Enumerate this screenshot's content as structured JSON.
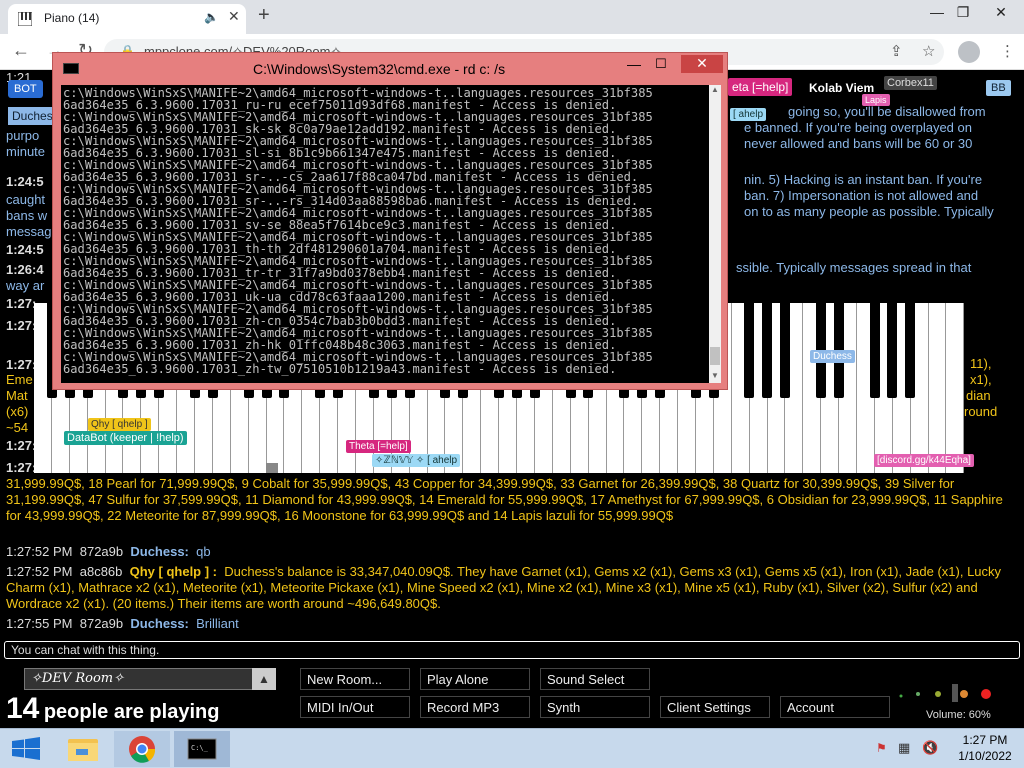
{
  "browser": {
    "tab_title": "Piano (14)",
    "url": "mppclone.com/?c=%E2%9C%A7DEV%20Room%E2%9C%A7",
    "url_display": "mppclone.com/✧DEV%20Room✧"
  },
  "page": {
    "bot_badge": "BOT",
    "duchess_tag": "Duches",
    "top_right_tag": "eta [=help]",
    "kolab": "Kolab Viem",
    "lapis": "Lapis",
    "corbex": "Corbex11",
    "bb": "BB",
    "right_chat_1": "going so, you'll be disallowed from",
    "right_chat_2": "e banned. If you're being overplayed on",
    "right_chat_3": "never allowed and bans will be 60 or 30",
    "right_chat_4": "nin. 5) Hacking is an instant ban. If you're",
    "right_chat_5": "ban. 7) Impersonation is not allowed and",
    "right_chat_6": "on to as many people as possible. Typically",
    "right_chat_7": "ssible. Typically messages spread in that",
    "left_frag_1": "1:21",
    "left_frag_2": "purpo",
    "left_frag_3": "minute",
    "left_frag_4": "1:24:5",
    "left_frag_5": "caught",
    "left_frag_6": "bans w",
    "left_frag_7": "messag",
    "left_frag_8": "1:24:5",
    "left_frag_9": "1:26:4",
    "left_frag_10": "way ar",
    "left_frag_11": "1:27:",
    "left_frag_12": "1:27:",
    "left_frag_13": "1:27:",
    "left_frag_14": "Eme",
    "left_frag_15": "Mat",
    "left_frag_16": "(x6)",
    "left_frag_17": "~54",
    "left_frag_18": "1:27:",
    "left_frag_19": "1:27:",
    "right_frag_1": "11),",
    "right_frag_2": "x1),",
    "right_frag_3": "dian",
    "right_frag_4": "round",
    "ahelp_tag": "[ ahelp",
    "qhy_tag": "Qhy [ qhelp ]",
    "databot_tag": "DataBot (keeper | !help)",
    "theta_tag": "Theta [=help]",
    "mid_tag": "✧ℤℕ𝕍𝕐 ✧ [ ahelp",
    "duchess_cursor": "Duchess",
    "discord_tag": "[discord.gg/k44Eqha]",
    "chat_market": "31,999.99Q$, 18 Pearl for 71,999.99Q$, 9 Cobalt for 35,999.99Q$, 43 Copper for 34,399.99Q$, 33 Garnet for 26,399.99Q$, 38 Quartz for 30,399.99Q$, 39 Silver for 31,199.99Q$, 47 Sulfur for 37,599.99Q$, 11 Diamond for 43,999.99Q$, 14 Emerald for 55,999.99Q$, 17 Amethyst for 67,999.99Q$, 6 Obsidian for 23,999.99Q$, 11 Sapphire for 43,999.99Q$, 22 Meteorite for 87,999.99Q$, 16 Moonstone for 63,999.99Q$ and 14 Lapis lazuli for 55,999.99Q$",
    "chat_1_time": "1:27:52 PM",
    "chat_1_id": "872a9b",
    "chat_1_name": "Duchess:",
    "chat_1_msg": "qb",
    "chat_2_time": "1:27:52 PM",
    "chat_2_id": "a8c86b",
    "chat_2_name": "Qhy [ qhelp ] :",
    "chat_2_msg": "Duchess's balance is 33,347,040.09Q$. They have Garnet (x1), Gems x2 (x1), Gems x3 (x1), Gems x5 (x1), Iron (x1), Jade (x1), Lucky Charm (x1), Mathrace x2 (x1), Meteorite (x1), Meteorite Pickaxe (x1), Mine Speed x2 (x1), Mine x2 (x1), Mine x3 (x1), Mine x5 (x1), Ruby (x1), Silver (x2), Sulfur (x2) and Wordrace x2 (x1). (20 items.) Their items are worth around ~496,649.80Q$.",
    "chat_3_time": "1:27:55 PM",
    "chat_3_id": "872a9b",
    "chat_3_name": "Duchess:",
    "chat_3_msg": "Brilliant",
    "chat_input": "You can chat with this thing."
  },
  "bottom": {
    "room_name": "✧DEV Room✧",
    "player_count": "14",
    "player_text": "people are playing",
    "buttons": [
      "New Room...",
      "Play Alone",
      "Sound Select",
      "MIDI In/Out",
      "Record MP3",
      "Synth",
      "Client Settings",
      "Account"
    ],
    "volume": "Volume: 60%"
  },
  "cmd": {
    "title": "C:\\Windows\\System32\\cmd.exe - rd  c: /s",
    "lines": [
      "c:\\Windows\\WinSxS\\MANIFE~2\\amd64_microsoft-windows-t..languages.resources_31bf385",
      "6ad364e35_6.3.9600.17031_ru-ru_ecef75011d93df68.manifest - Access is denied.",
      "c:\\Windows\\WinSxS\\MANIFE~2\\amd64_microsoft-windows-t..languages.resources_31bf385",
      "6ad364e35_6.3.9600.17031_sk-sk_8c0a79ae12add192.manifest - Access is denied.",
      "c:\\Windows\\WinSxS\\MANIFE~2\\amd64_microsoft-windows-t..languages.resources_31bf385",
      "6ad364e35_6.3.9600.17031_sl-si_8b1c9b661347e475.manifest - Access is denied.",
      "c:\\Windows\\WinSxS\\MANIFE~2\\amd64_microsoft-windows-t..languages.resources_31bf385",
      "6ad364e35_6.3.9600.17031_sr-..-cs_2aa617f88ca047bd.manifest - Access is denied.",
      "c:\\Windows\\WinSxS\\MANIFE~2\\amd64_microsoft-windows-t..languages.resources_31bf385",
      "6ad364e35_6.3.9600.17031_sr-..-rs_314d03aa88598ba6.manifest - Access is denied.",
      "c:\\Windows\\WinSxS\\MANIFE~2\\amd64_microsoft-windows-t..languages.resources_31bf385",
      "6ad364e35_6.3.9600.17031_sv-se_88ea5f7614bce9c3.manifest - Access is denied.",
      "c:\\Windows\\WinSxS\\MANIFE~2\\amd64_microsoft-windows-t..languages.resources_31bf385",
      "6ad364e35_6.3.9600.17031_th-th_2df481290601a704.manifest - Access is denied.",
      "c:\\Windows\\WinSxS\\MANIFE~2\\amd64_microsoft-windows-t..languages.resources_31bf385",
      "6ad364e35_6.3.9600.17031_tr-tr_31f7a9bd0378ebb4.manifest - Access is denied.",
      "c:\\Windows\\WinSxS\\MANIFE~2\\amd64_microsoft-windows-t..languages.resources_31bf385",
      "6ad364e35_6.3.9600.17031_uk-ua_cdd78c63faaa1200.manifest - Access is denied.",
      "c:\\Windows\\WinSxS\\MANIFE~2\\amd64_microsoft-windows-t..languages.resources_31bf385",
      "6ad364e35_6.3.9600.17031_zh-cn_0354c7bab3b0bdd3.manifest - Access is denied.",
      "c:\\Windows\\WinSxS\\MANIFE~2\\amd64_microsoft-windows-t..languages.resources_31bf385",
      "6ad364e35_6.3.9600.17031_zh-hk_01ffc048b48c3063.manifest - Access is denied.",
      "c:\\Windows\\WinSxS\\MANIFE~2\\amd64_microsoft-windows-t..languages.resources_31bf385",
      "6ad364e35_6.3.9600.17031_zh-tw_07510510b1219a43.manifest - Access is denied."
    ]
  },
  "taskbar": {
    "time": "1:27 PM",
    "date": "1/10/2022"
  },
  "colors": {
    "cmd_frame": "#e67f7f",
    "taskbar": "#c7d9ec",
    "chat_gold": "#f0c419",
    "duchess_blue": "#8db8e8"
  }
}
